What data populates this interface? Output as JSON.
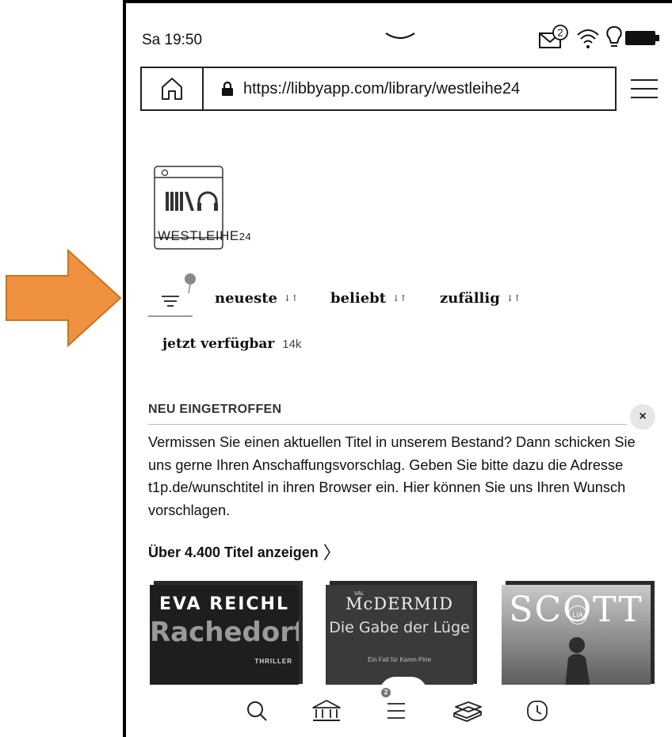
{
  "status": {
    "time": "Sa 19:50",
    "mail_badge": "2"
  },
  "browser": {
    "url": "https://libbyapp.com/library/westleihe24"
  },
  "library": {
    "logo_text": "WESTLEIHE",
    "logo_suffix": "24"
  },
  "sort": {
    "options": [
      "neueste",
      "beliebt",
      "zufällig"
    ],
    "arrow_glyph": "↓↑"
  },
  "availability": {
    "label": "jetzt verfügbar",
    "count": "14k"
  },
  "section": {
    "title": "NEU EINGETROFFEN",
    "close": "×",
    "notice": "Vermissen Sie einen aktuellen Titel in unserem Bestand? Dann schicken Sie uns gerne Ihren Anschaffungsvorschlag. Geben Sie bitte dazu die Adresse t1p.de/wunschtitel in ihren Browser ein. Hier können Sie uns Ihren Wunsch vorschlagen.",
    "show_all": "Über 4.400 Titel anzeigen",
    "show_all_chevron": "〉"
  },
  "books": [
    {
      "author": "EVA REICHL",
      "title": "Rachedorf",
      "genre": "THRILLER"
    },
    {
      "author": "McDERMID",
      "author_prefix": "VAL",
      "title": "Die Gabe der Lüge",
      "subtitle": "Ein Fall für Karen Pirie"
    },
    {
      "author": "SCOTT",
      "author_prefix": "LIA"
    }
  ],
  "nav": {
    "queue_badge": "2",
    "icons": [
      "search-icon",
      "library-icon",
      "menu-icon",
      "shelf-icon",
      "history-icon"
    ]
  },
  "colors": {
    "arrow_fill": "#F0913F",
    "arrow_stroke": "#C87420",
    "device_border": "#000000"
  }
}
